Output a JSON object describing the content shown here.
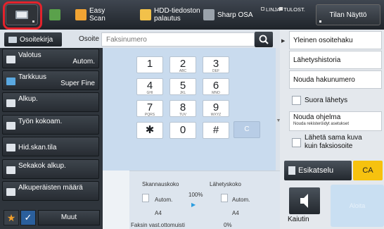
{
  "colors": {
    "highlight": "#e3232c",
    "accent": "#f6c20f",
    "topbar": "#2a3036"
  },
  "topbar": {
    "home_icon": "home-screen-icon",
    "shortcuts": [
      {
        "label": "Easy\nScan",
        "icon": "easy-scan-icon"
      },
      {
        "label": "HDD-tiedoston\npalautus",
        "icon": "hdd-file-icon"
      },
      {
        "label": "Sharp OSA",
        "icon": "sharp-osa-icon"
      }
    ],
    "status_line": "LINJA",
    "status_print": "TULOST.",
    "tilan_label": "Tilan Näyttö"
  },
  "address": {
    "book_label": "Osoitekirja",
    "osoite_label": "Osoite",
    "placeholder": "Faksinumero"
  },
  "settings": [
    {
      "name": "Valotus",
      "value": "Autom."
    },
    {
      "name": "Tarkkuus",
      "value": "Super Fine"
    },
    {
      "name": "Alkup.",
      "value": ""
    },
    {
      "name": "Työn kokoam.",
      "value": ""
    },
    {
      "name": "Hid.skan.tila",
      "value": ""
    },
    {
      "name": "Sekakok alkup.",
      "value": ""
    },
    {
      "name": "Alkuperäisten määrä",
      "value": ""
    }
  ],
  "bottom_left": {
    "muut_label": "Muut"
  },
  "keypad": {
    "keys": [
      {
        "d": "1",
        "s": ""
      },
      {
        "d": "2",
        "s": "ABC"
      },
      {
        "d": "3",
        "s": "DEF"
      },
      {
        "d": "4",
        "s": "GHI"
      },
      {
        "d": "5",
        "s": "JKL"
      },
      {
        "d": "6",
        "s": "MNO"
      },
      {
        "d": "7",
        "s": "PQRS"
      },
      {
        "d": "8",
        "s": "TUV"
      },
      {
        "d": "9",
        "s": "WXYZ"
      },
      {
        "d": "✱",
        "s": ""
      },
      {
        "d": "0",
        "s": ""
      },
      {
        "d": "#",
        "s": ""
      }
    ],
    "c_label": "C"
  },
  "scan": {
    "scan_size_label": "Skannauskoko",
    "send_size_label": "Lähetyskoko",
    "scan_mode": "Autom.",
    "send_mode": "Autom.",
    "zoom": "100%",
    "scan_paper": "A4",
    "send_paper": "A4",
    "memory_label": "Faksin vast.ottomuisti",
    "memory_value": "0%"
  },
  "right_panel": {
    "items": [
      "Yleinen osoitehaku",
      "Lähetyshistoria",
      "Nouda hakunumero"
    ],
    "suora_label": "Suora lähetys",
    "nouda_ohjelma": "Nouda ohjelma",
    "nouda_sub": "Nouda rekisteröidyt asetukset",
    "sama_kuva": "Lähetä sama kuva\nkuin faksiosoite",
    "esikatselu": "Esikatselu",
    "ca": "CA",
    "kaiutin": "Kaiutin",
    "aloita": "Aloita"
  }
}
